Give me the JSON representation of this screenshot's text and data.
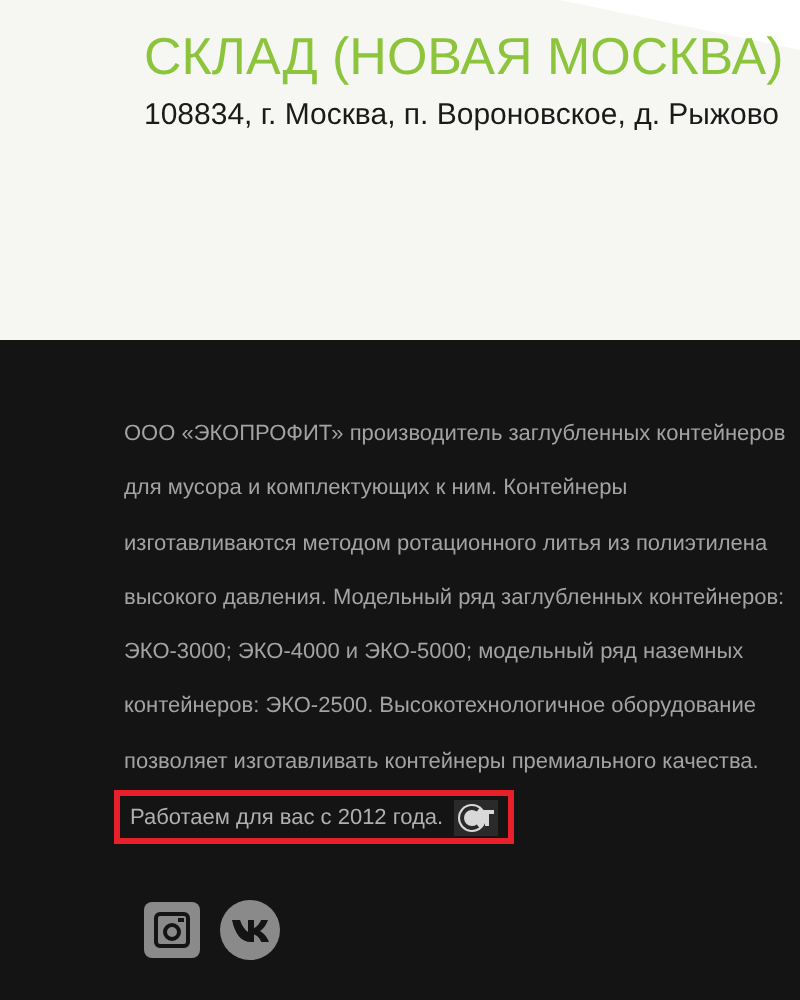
{
  "warehouse": {
    "title": "СКЛАД (НОВАЯ МОСКВА)",
    "address": "108834, г. Москва, п. Вороновское, д. Рыжово"
  },
  "footer": {
    "about": "ООО «ЭКОПРОФИТ» производитель заглубленных контейнеров\nдля мусора и комплектующих к ним. Контейнеры\nизготавливаются методом ротационного литья из полиэтилена\nвысокого давления. Модельный ряд заглубленных контейнеров:\nЭКО-3000; ЭКО-4000 и ЭКО-5000; модельный ряд наземных\nконтейнеров: ЭКО-2500. Высокотехнологичное оборудование\nпозволяет изготавливать контейнеры премиального качества.",
    "since": "Работаем для вас с 2012 года.",
    "highlighted": true
  }
}
